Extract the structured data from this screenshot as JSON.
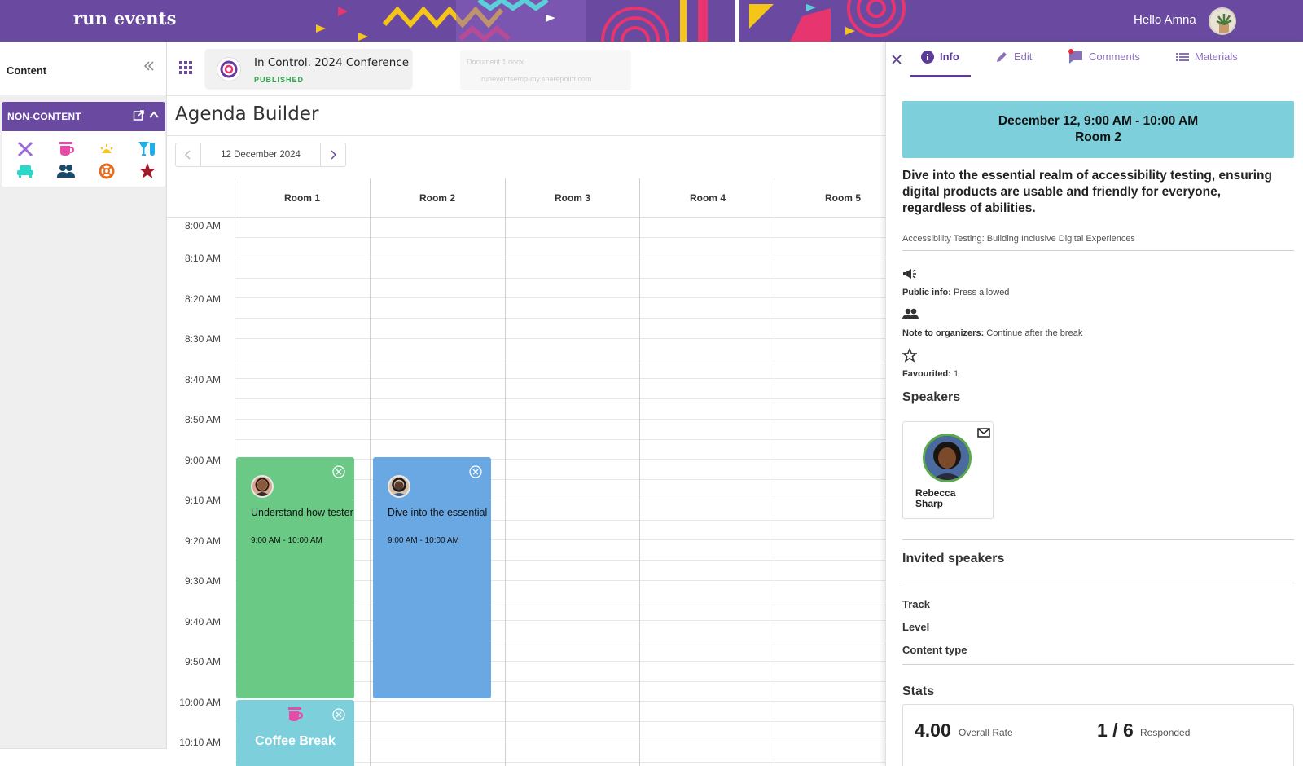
{
  "topbar": {
    "logo": "run events",
    "greeting": "Hello Amna"
  },
  "sidebar": {
    "title": "Content",
    "non_content": {
      "label": "NON-CONTENT",
      "icons": [
        "fork-knife-icon",
        "coffee-cup-icon",
        "sunrise-icon",
        "drinks-icon",
        "lounge-chair-icon",
        "people-icon",
        "lifebuoy-icon",
        "star-icon"
      ]
    }
  },
  "conference": {
    "name": "In Control. 2024 Conference",
    "status": "PUBLISHED"
  },
  "ghost": {
    "line1": "Document 1.docx",
    "line2": "runeventsemp-my.sharepoint.com"
  },
  "page": {
    "title": "Agenda Builder"
  },
  "date_nav": {
    "date": "12 December 2024"
  },
  "calendar": {
    "rooms": [
      "Room 1",
      "Room 2",
      "Room 3",
      "Room 4",
      "Room 5"
    ],
    "times": [
      "8:00 AM",
      "8:10 AM",
      "8:20 AM",
      "8:30 AM",
      "8:40 AM",
      "8:50 AM",
      "9:00 AM",
      "9:10 AM",
      "9:20 AM",
      "9:30 AM",
      "9:40 AM",
      "9:50 AM",
      "10:00 AM",
      "10:10 AM"
    ],
    "events": [
      {
        "title": "Understand how tester",
        "time": "9:00 AM - 10:00 AM",
        "room": "Room 1",
        "color": "#6ac985"
      },
      {
        "title": "Dive into the essential",
        "time": "9:00 AM - 10:00 AM",
        "room": "Room 2",
        "color": "#6aa8e4"
      },
      {
        "title": "Coffee Break",
        "room": "Room 1",
        "color": "#7ccfdb"
      }
    ]
  },
  "panel": {
    "tabs": [
      {
        "label": "Info",
        "icon": "info-icon",
        "active": true
      },
      {
        "label": "Edit",
        "icon": "pencil-icon"
      },
      {
        "label": "Comments",
        "icon": "comment-icon"
      },
      {
        "label": "Materials",
        "icon": "list-icon"
      }
    ],
    "banner_line1": "December 12, 9:00 AM - 10:00 AM",
    "banner_line2": "Room 2",
    "description": "Dive into the essential realm of accessibility testing, ensuring digital products are usable and friendly for everyone, regardless of abilities.",
    "session_title": "Accessibility Testing: Building Inclusive Digital Experiences",
    "public_info_label": "Public info:",
    "public_info_value": "Press allowed",
    "note_label": "Note to organizers:",
    "note_value": "Continue after the break",
    "favourited_label": "Favourited:",
    "favourited_value": "1",
    "speakers_heading": "Speakers",
    "speaker_first": "Rebecca",
    "speaker_last": "Sharp",
    "invited_heading": "Invited speakers",
    "track_label": "Track",
    "level_label": "Level",
    "content_type_label": "Content type",
    "stats_heading": "Stats",
    "overall_rate_value": "4.00",
    "overall_rate_label": "Overall Rate",
    "responded_value": "1 / 6",
    "responded_label": "Responded"
  }
}
